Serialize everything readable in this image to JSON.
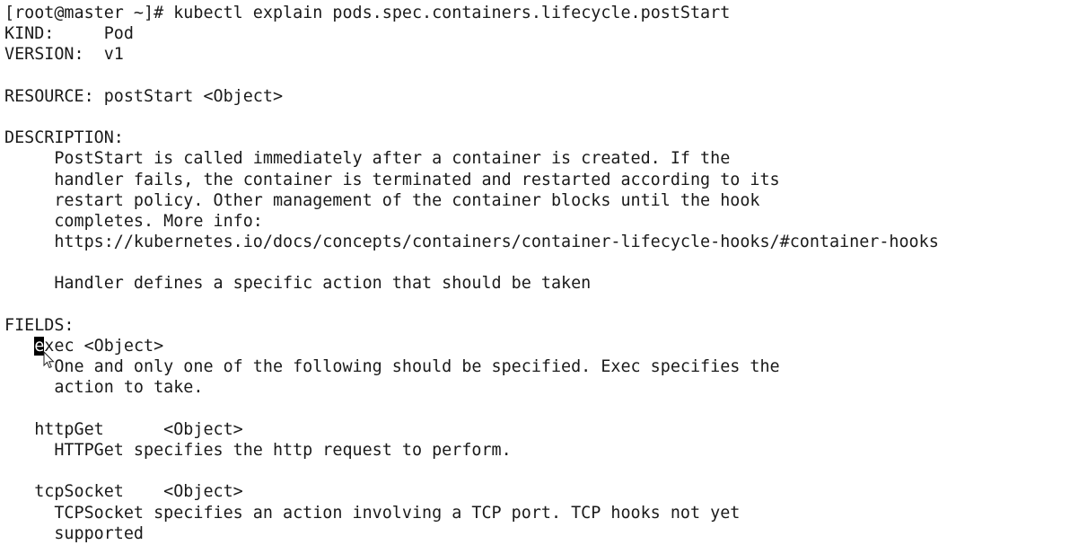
{
  "terminal": {
    "prompt": "[root@master ~]# ",
    "command": "kubectl explain pods.spec.containers.lifecycle.postStart",
    "cursor_char": "e",
    "lines": [
      "KIND:     Pod",
      "VERSION:  v1",
      "",
      "RESOURCE: postStart <Object>",
      "",
      "DESCRIPTION:",
      "     PostStart is called immediately after a container is created. If the",
      "     handler fails, the container is terminated and restarted according to its",
      "     restart policy. Other management of the container blocks until the hook",
      "     completes. More info:",
      "     https://kubernetes.io/docs/concepts/containers/container-lifecycle-hooks/#container-hooks",
      "",
      "     Handler defines a specific action that should be taken",
      "",
      "FIELDS:"
    ],
    "exec_field": {
      "indent": "   ",
      "rest": "xec <Object>",
      "desc": [
        "     One and only one of the following should be specified. Exec specifies the",
        "     action to take."
      ]
    },
    "after_exec": [
      "",
      "   httpGet      <Object>",
      "     HTTPGet specifies the http request to perform.",
      "",
      "   tcpSocket    <Object>",
      "     TCPSocket specifies an action involving a TCP port. TCP hooks not yet",
      "     supported"
    ]
  }
}
